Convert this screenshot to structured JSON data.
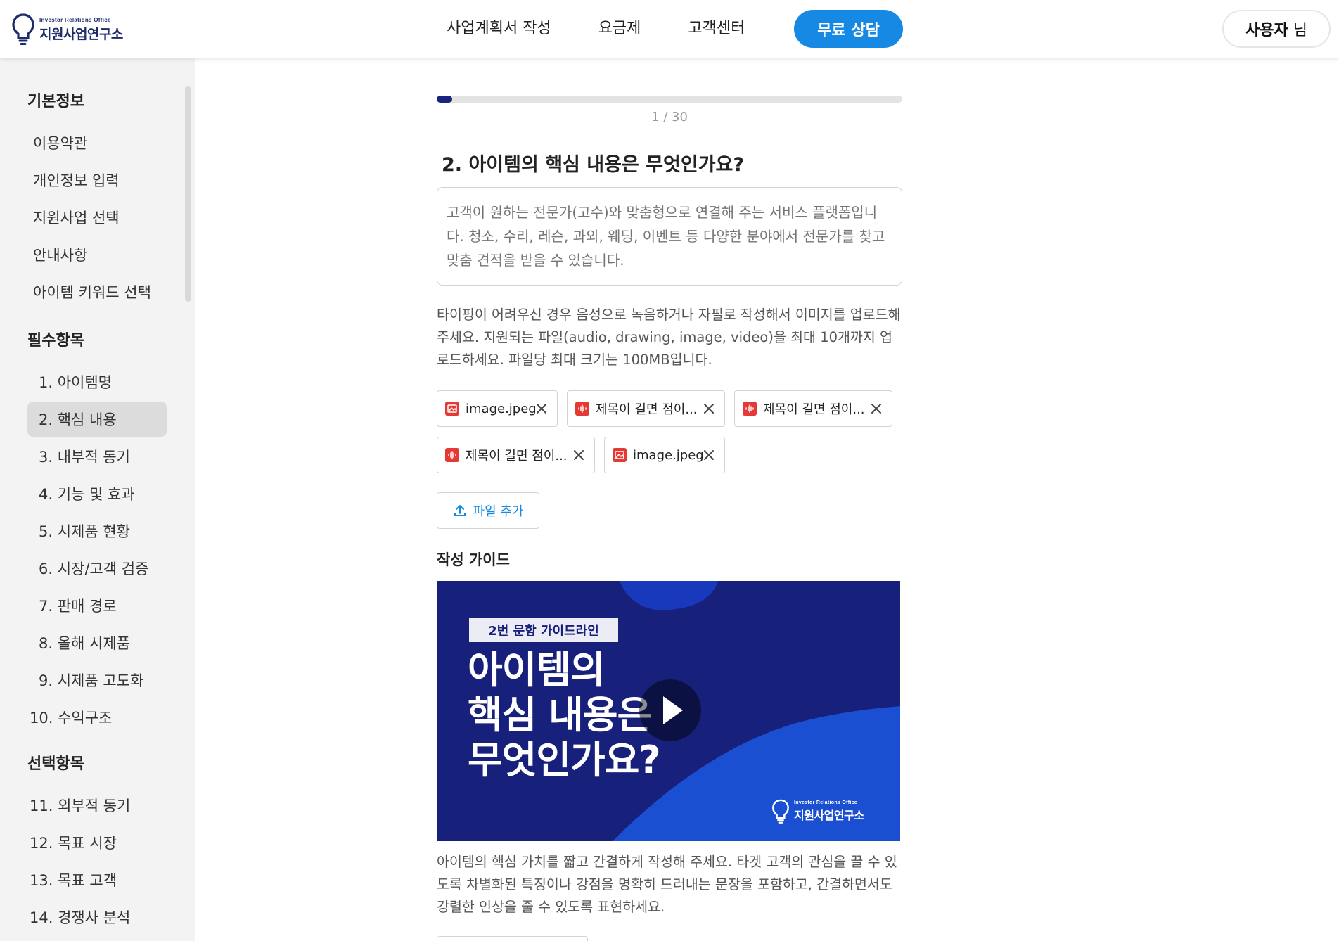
{
  "header": {
    "logo_sub": "Investor Relations Office",
    "logo_main": "지원사업연구소",
    "nav": [
      "사업계획서 작성",
      "요금제",
      "고객센터"
    ],
    "consult_button": "무료 상담",
    "user_name": "사용자",
    "user_suffix": " 님"
  },
  "sidebar": {
    "basic_title": "기본정보",
    "basic_items": [
      "이용약관",
      "개인정보 입력",
      "지원사업 선택",
      "안내사항",
      "아이템 키워드 선택"
    ],
    "required_title": "필수항목",
    "required_items": [
      "1. 아이템명",
      "2. 핵심 내용",
      "3. 내부적 동기",
      "4. 기능 및 효과",
      "5. 시제품 현황",
      "6. 시장/고객 검증",
      "7. 판매 경로",
      "8. 올해 시제품",
      "9. 시제품 고도화",
      "10. 수익구조"
    ],
    "optional_title": "선택항목",
    "optional_items": [
      "11. 외부적 동기",
      "12. 목표 시장",
      "13. 목표 고객",
      "14. 경쟁사 분석"
    ],
    "active_item": "2. 핵심 내용"
  },
  "main": {
    "progress_text": "1 / 30",
    "progress_fraction": 0.0333,
    "question": "2. 아이템의 핵심 내용은 무엇인가요?",
    "answer_placeholder": "고객이 원하는 전문가(고수)와 맞춤형으로 연결해 주는 서비스 플랫폼입니다. 청소, 수리, 레슨, 과외, 웨딩, 이벤트 등 다양한 분야에서 전문가를 찾고 맞춤 견적을 받을 수 있습니다.",
    "help_text": "타이핑이 어려우신 경우 음성으로 녹음하거나 자필로 작성해서 이미지를 업로드해 주세요. 지원되는 파일(audio, drawing, image, video)을 최대 10개까지 업로드하세요. 파일당 최대 크기는 100MB입니다.",
    "files": [
      {
        "name": "image.jpeg",
        "icon": "image-icon"
      },
      {
        "name": "제목이 길면 점이...",
        "icon": "audio-icon"
      },
      {
        "name": "제목이 길면 점이...",
        "icon": "audio-icon"
      },
      {
        "name": "제목이 길면 점이...",
        "icon": "audio-icon"
      },
      {
        "name": "image.jpeg",
        "icon": "image-icon"
      }
    ],
    "add_file_label": "파일 추가",
    "guide_title": "작성 가이드",
    "video_tag": "2번 문항 가이드라인",
    "video_title": "아이템의\n핵심 내용은\n무엇인가요?",
    "guide_desc": "아이템의 핵심 가치를 짧고 간결하게 작성해 주세요. 타겟 고객의 관심을 끌 수 있도록 차별화된 특징이나 강점을 명확히 드러내는 문장을 포함하고, 간결하면서도 강렬한 인상을 줄 수 있도록 표현하세요."
  },
  "colors": {
    "accent": "#1589e3",
    "navy": "#1a237e",
    "file_icon": "#e53935"
  }
}
